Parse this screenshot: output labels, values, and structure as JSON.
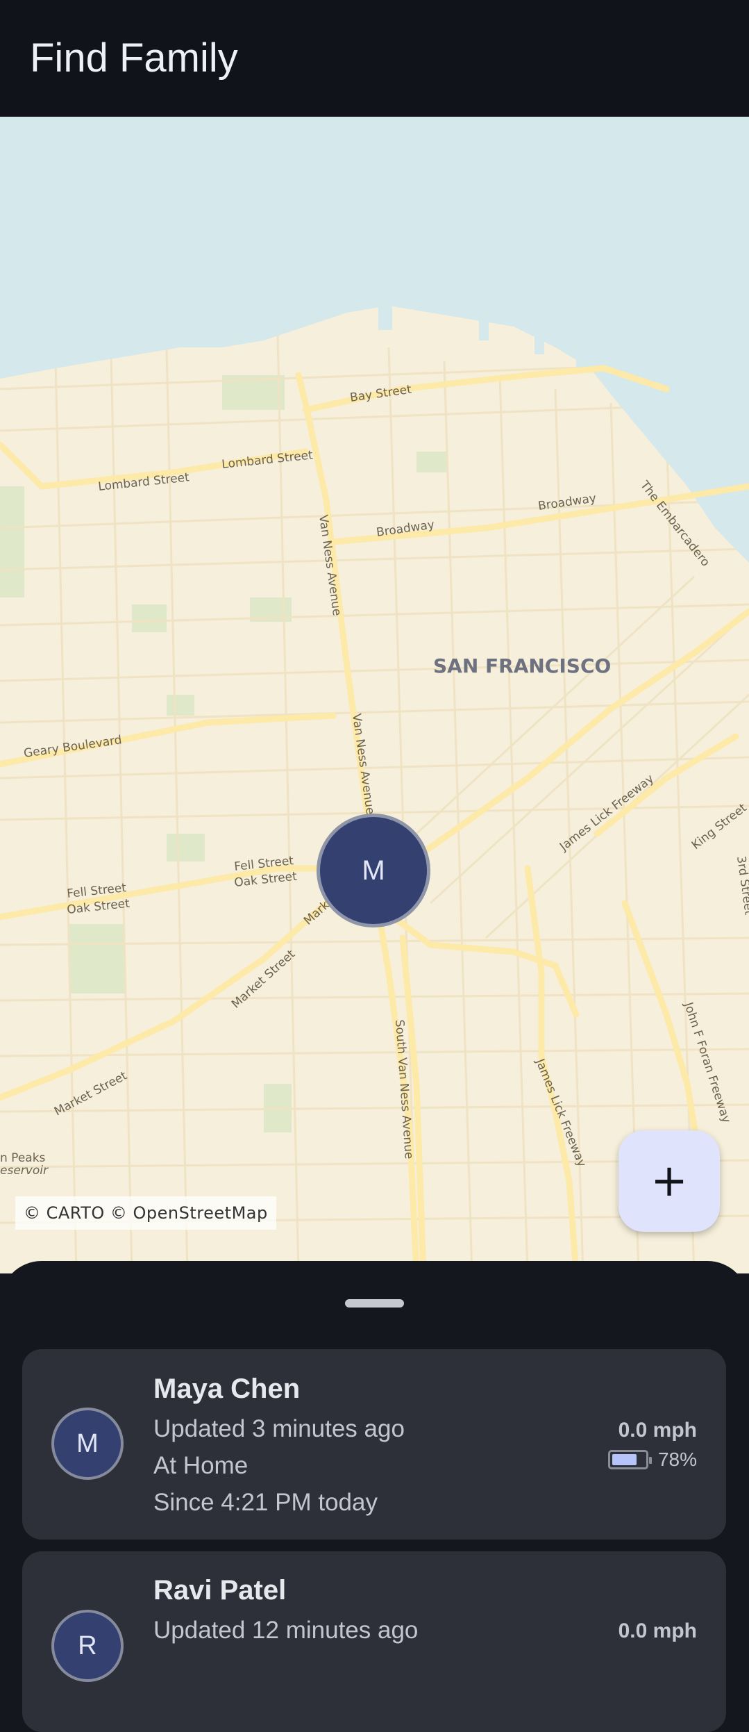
{
  "app": {
    "title": "Find Family"
  },
  "map": {
    "attribution": "© CARTO © OpenStreetMap",
    "marker_initial": "M",
    "labels": {
      "city": "SAN FRANCISCO",
      "bay_street": "Bay Street",
      "lombard_1": "Lombard Street",
      "lombard_2": "Lombard Street",
      "broadway_1": "Broadway",
      "broadway_2": "Broadway",
      "van_ness_1": "Van Ness Avenue",
      "van_ness_2": "Van Ness Avenue",
      "embarcadero": "The Embarcadero",
      "geary": "Geary Boulevard",
      "fell_1": "Fell Street",
      "oak_1": "Oak Street",
      "fell_2": "Fell Street",
      "oak_2": "Oak Street",
      "market_1": "Market Street",
      "market_2": "Market Street",
      "market_3": "Marke",
      "james_lick_1": "James Lick Freeway",
      "james_lick_2": "James Lick Freeway",
      "king": "King Street",
      "third": "3rd Street",
      "south_van_ness": "South Van Ness Avenue",
      "john_foran": "John F Foran Freeway",
      "reservoir_1": "n Peaks",
      "reservoir_2": "eservoir"
    }
  },
  "fab": {
    "icon": "add-icon",
    "glyph": "+"
  },
  "members": [
    {
      "initial": "M",
      "name": "Maya Chen",
      "updated": "Updated 3 minutes ago",
      "place": "At Home",
      "since": "Since 4:21 PM today",
      "speed": "0.0 mph",
      "battery_text": "78%",
      "battery_level": 0.78
    },
    {
      "initial": "R",
      "name": "Ravi Patel",
      "updated": "Updated 12 minutes ago",
      "speed": "0.0 mph"
    }
  ],
  "colors": {
    "appbar": "#11131b",
    "sheet": "#15171f",
    "card": "#2e3039",
    "avatar": "#334070",
    "fab": "#dfe3fb",
    "water": "#d5e8eb",
    "land": "#f6efdb",
    "road": "#fde9a8",
    "park": "#dfe8c8",
    "battery_fill": "#b6c4fb"
  }
}
